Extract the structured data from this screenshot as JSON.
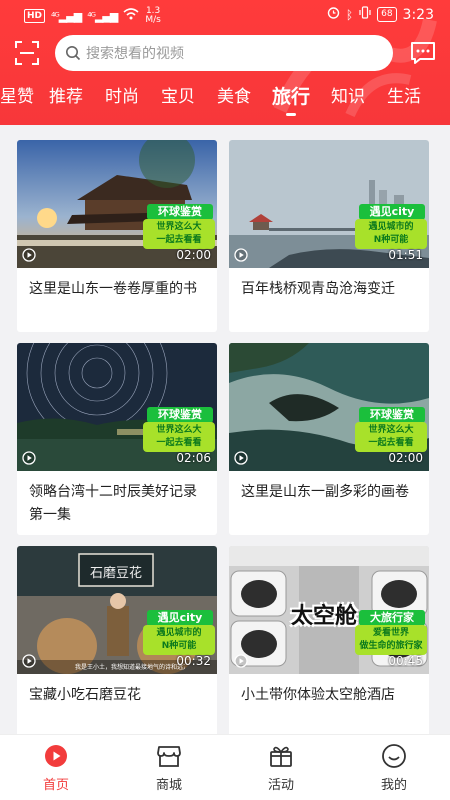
{
  "status_bar": {
    "hd": "HD",
    "signal1": "⁴ᴳ",
    "signal2": "⁴ᴳ",
    "speed_value": "1.3",
    "speed_unit": "M/s",
    "battery": "68",
    "time": "3:23"
  },
  "search": {
    "placeholder": "搜索想看的视频"
  },
  "tabs": [
    {
      "label": "星赞",
      "active": false
    },
    {
      "label": "推荐",
      "active": false
    },
    {
      "label": "时尚",
      "active": false
    },
    {
      "label": "宝贝",
      "active": false
    },
    {
      "label": "美食",
      "active": false
    },
    {
      "label": "旅行",
      "active": true
    },
    {
      "label": "知识",
      "active": false
    },
    {
      "label": "生活",
      "active": false
    }
  ],
  "cards": [
    {
      "title": "这里是山东一卷卷厚重的书",
      "duration": "02:00",
      "badge_head": "环球鉴赏",
      "badge_line1": "世界这么大",
      "badge_line2": "一起去看看"
    },
    {
      "title": "百年栈桥观青岛沧海变迁",
      "duration": "01:51",
      "badge_head": "遇见city",
      "badge_line1": "遇见城市的",
      "badge_line2": "N种可能"
    },
    {
      "title": "领略台湾十二时辰美好记录第一集",
      "duration": "02:06",
      "badge_head": "环球鉴赏",
      "badge_line1": "世界这么大",
      "badge_line2": "一起去看看"
    },
    {
      "title": "这里是山东一副多彩的画卷",
      "duration": "02:00",
      "badge_head": "环球鉴赏",
      "badge_line1": "世界这么大",
      "badge_line2": "一起去看看"
    },
    {
      "title": "宝藏小吃石磨豆花",
      "duration": "00:32",
      "badge_head": "遇见city",
      "badge_line1": "遇见城市的",
      "badge_line2": "N种可能",
      "overlay_sign": "石磨豆花",
      "overlay_caption": "我是王小土，我想知道最接地气的诗和远方"
    },
    {
      "title": "小土带你体验太空舱酒店",
      "duration": "00:45",
      "badge_head": "大旅行家",
      "badge_line1": "爱看世界",
      "badge_line2": "做生命的旅行家",
      "overlay_big": "太空舱"
    }
  ],
  "bottom_nav": [
    {
      "label": "首页",
      "icon": "home-play-icon",
      "active": true
    },
    {
      "label": "商城",
      "icon": "shop-icon",
      "active": false
    },
    {
      "label": "活动",
      "icon": "gift-icon",
      "active": false
    },
    {
      "label": "我的",
      "icon": "smile-icon",
      "active": false
    }
  ],
  "colors": {
    "brand_red": "#f7373a",
    "badge_green": "#1bbf3c",
    "badge_lime": "#a8e12a"
  }
}
